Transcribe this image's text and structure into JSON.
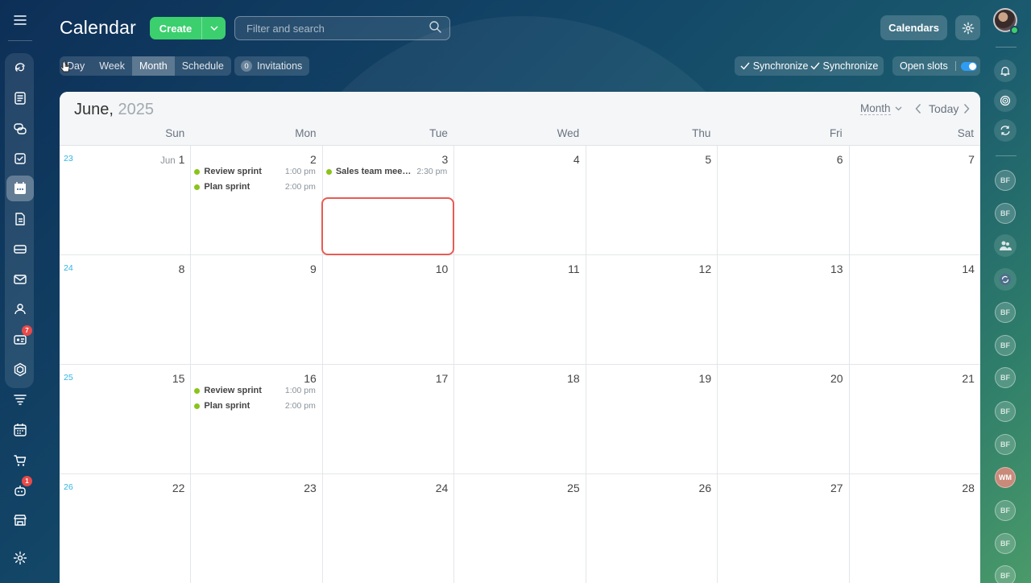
{
  "header": {
    "title": "Calendar",
    "create_label": "Create",
    "search_placeholder": "Filter and search",
    "calendars_label": "Calendars"
  },
  "toolbar": {
    "views": [
      "Day",
      "Week",
      "Month",
      "Schedule"
    ],
    "active_view": "Month",
    "invitations_count": "0",
    "invitations_label": "Invitations",
    "sync_label_1": "Synchronize",
    "sync_label_2": "Synchronize",
    "open_slots_label": "Open slots",
    "open_slots_on": true
  },
  "calendar": {
    "month": "June,",
    "year": "2025",
    "view_select": "Month",
    "today_label": "Today",
    "weekdays": [
      "Sun",
      "Mon",
      "Tue",
      "Wed",
      "Thu",
      "Fri",
      "Sat"
    ],
    "first_day_month_label": "Jun",
    "weeks": [
      {
        "week": "23",
        "days": [
          "1",
          "2",
          "3",
          "4",
          "5",
          "6",
          "7"
        ]
      },
      {
        "week": "24",
        "days": [
          "8",
          "9",
          "10",
          "11",
          "12",
          "13",
          "14"
        ]
      },
      {
        "week": "25",
        "days": [
          "15",
          "16",
          "17",
          "18",
          "19",
          "20",
          "21"
        ]
      },
      {
        "week": "26",
        "days": [
          "22",
          "23",
          "24",
          "25",
          "26",
          "27",
          "28"
        ]
      }
    ],
    "events": {
      "jun2_a": {
        "title": "Review sprint",
        "time": "1:00 pm"
      },
      "jun2_b": {
        "title": "Plan sprint",
        "time": "2:00 pm"
      },
      "jun3_a": {
        "title": "Sales team meeting",
        "time": "2:30 pm"
      },
      "jun16_a": {
        "title": "Review sprint",
        "time": "1:00 pm"
      },
      "jun16_b": {
        "title": "Plan sprint",
        "time": "2:00 pm"
      }
    },
    "event_color": "#8ac41a",
    "highlight_color": "#e85b55"
  },
  "left_rail": {
    "badges": {
      "contacts": "7",
      "robot": "1"
    }
  },
  "right_rail": {
    "avatars": [
      "BF",
      "BF",
      "BF",
      "BF",
      "BF",
      "BF",
      "BF",
      "BF",
      "WM",
      "BF",
      "BF",
      "BF"
    ]
  }
}
